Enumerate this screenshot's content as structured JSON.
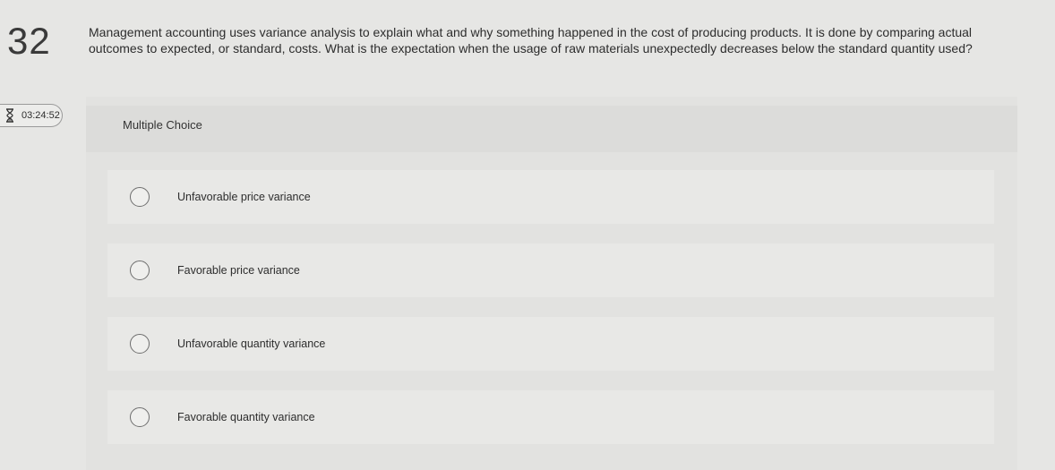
{
  "question": {
    "number": "32",
    "text": "Management accounting uses variance analysis to explain what and why something happened in the cost of producing products. It is done by comparing actual outcomes to expected, or standard, costs. What is the expectation when the usage of raw materials unexpectedly decreases below the standard quantity used?"
  },
  "timer": {
    "icon": "hourglass-icon",
    "value": "03:24:52"
  },
  "panel": {
    "type_label": "Multiple Choice"
  },
  "options": [
    {
      "label": "Unfavorable price variance"
    },
    {
      "label": "Favorable price variance"
    },
    {
      "label": "Unfavorable quantity variance"
    },
    {
      "label": "Favorable quantity variance"
    }
  ]
}
